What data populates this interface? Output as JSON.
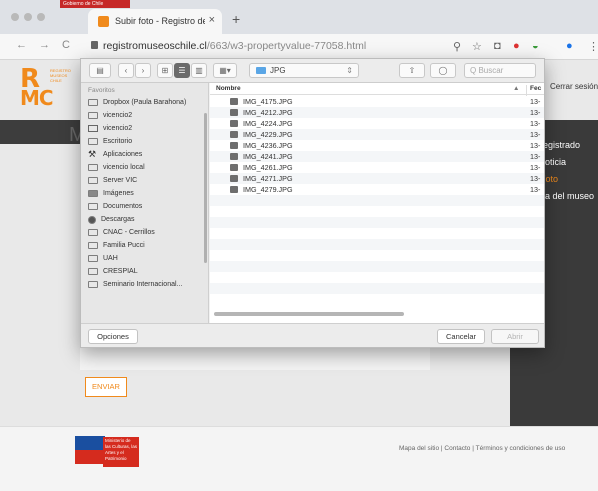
{
  "browser": {
    "top_strip_text": "Gobierno de Chile",
    "tab_title": "Subir foto - Registro de Museo",
    "tab_close": "×",
    "new_tab": "+",
    "url_host": "registromuseoschile.cl",
    "url_path": "/663/w3-propertyvalue-77058.html",
    "back": "←",
    "forward": "→",
    "reload": "C"
  },
  "page": {
    "logo_letters_top": "R",
    "logo_letters_bottom": "MC",
    "logo_small": "REGISTRO MUSEOS CHILE",
    "heading_letter": "M",
    "cerrar_sesion": "Cerrar sesión",
    "sidebar_links": [
      "registrado",
      "noticia",
      "Foto",
      "na del museo"
    ],
    "enviar": "ENVIAR",
    "gob_text": "Ministerio de las Culturas, las Artes y el Patrimonio",
    "footer_links": "Mapa del sitio  |  Contacto  |  Términos y condiciones de uso"
  },
  "dialog": {
    "toolbar": {
      "sidebar_toggle": "▤",
      "back": "‹",
      "forward": "›",
      "view_icons": "⊞",
      "view_list": "☰",
      "view_columns": "▥",
      "view_gallery": "▦▾",
      "folder": "JPG",
      "share": "⇧",
      "tag": "◯",
      "search_placeholder": "Q Buscar"
    },
    "sidebar_heading": "Favoritos",
    "sidebar_items": [
      "Dropbox (Paula Barahona)",
      "vicencio2",
      "vicencio2",
      "Escritorio",
      "Aplicaciones",
      "vicencio local",
      "Server VIC",
      "Imágenes",
      "Documentos",
      "Descargas",
      "CNAC - Cerrillos",
      "Familia Pucci",
      "UAH",
      "CRESPIAL",
      "Seminario Internacional..."
    ],
    "columns": {
      "name": "Nombre",
      "date": "Fec",
      "sort": "▲"
    },
    "files": [
      {
        "name": "IMG_4175.JPG",
        "date": "13-"
      },
      {
        "name": "IMG_4212.JPG",
        "date": "13-"
      },
      {
        "name": "IMG_4224.JPG",
        "date": "13-"
      },
      {
        "name": "IMG_4229.JPG",
        "date": "13-"
      },
      {
        "name": "IMG_4236.JPG",
        "date": "13-"
      },
      {
        "name": "IMG_4241.JPG",
        "date": "13-"
      },
      {
        "name": "IMG_4261.JPG",
        "date": "13-"
      },
      {
        "name": "IMG_4271.JPG",
        "date": "13-"
      },
      {
        "name": "IMG_4279.JPG",
        "date": "13-"
      }
    ],
    "options_button": "Opciones",
    "cancel_button": "Cancelar",
    "open_button": "Abrir"
  }
}
